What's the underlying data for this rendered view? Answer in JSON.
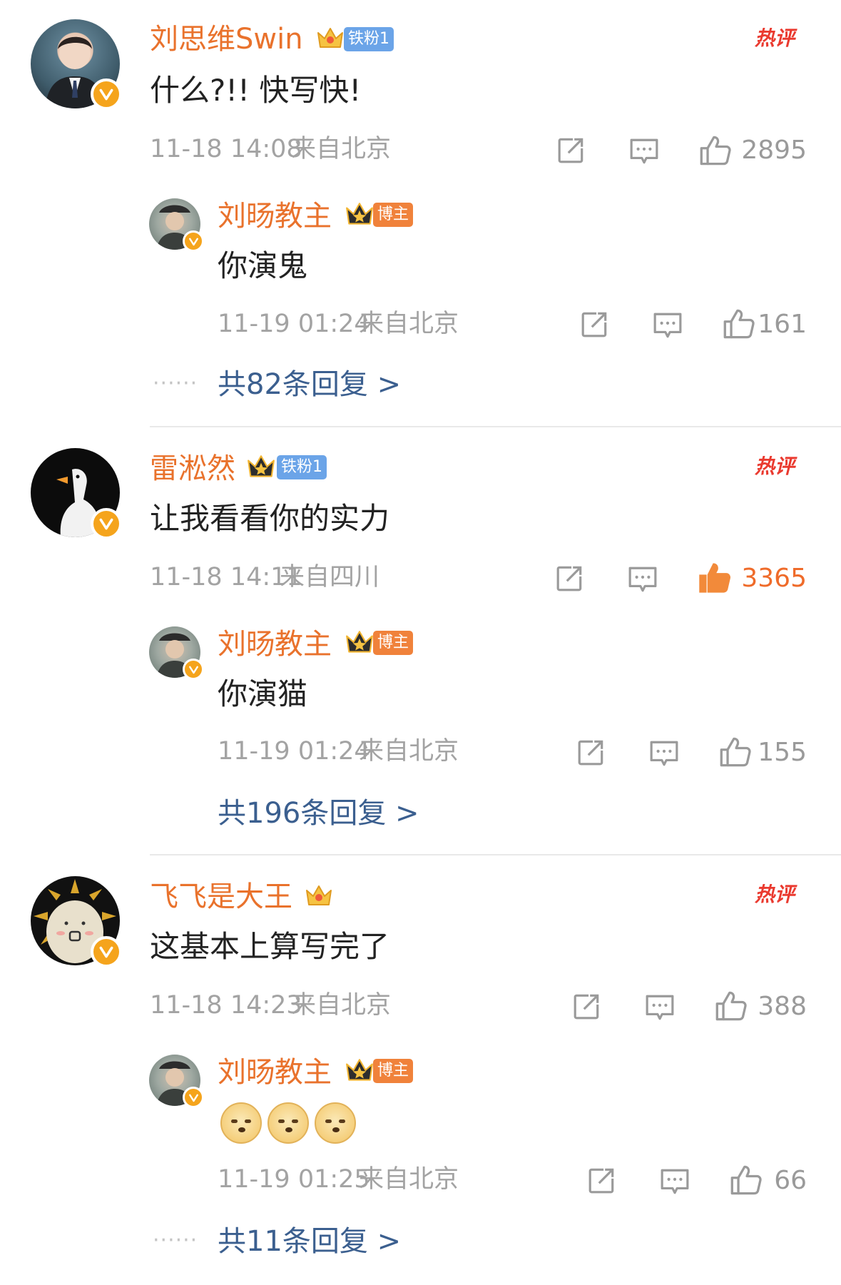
{
  "colors": {
    "name": "#e9722c",
    "link": "#3b5f8f",
    "meta": "#a3a3a3",
    "hot": "#ea3a2f",
    "liked": "#ef6b2a"
  },
  "comments": [
    {
      "user": "刘思维Swin",
      "crown_level": "7",
      "fan_badge": "铁粉1",
      "hot_tag": "热评",
      "text": "什么?!!  快写快!",
      "time": "11-18 14:08",
      "location": "来自北京",
      "likes": "2895",
      "liked": false,
      "reply": {
        "user": "刘旸教主",
        "crown_level": "II",
        "badge": "博主",
        "text": "你演鬼",
        "time": "11-19 01:24",
        "location": "来自北京",
        "likes": "161"
      },
      "more": "共82条回复 >",
      "more_dots": "······"
    },
    {
      "user": "雷淞然",
      "crown_level": "II",
      "fan_badge": "铁粉1",
      "hot_tag": "热评",
      "text": "让我看看你的实力",
      "time": "11-18 14:11",
      "location": "来自四川",
      "likes": "3365",
      "liked": true,
      "reply": {
        "user": "刘旸教主",
        "crown_level": "II",
        "badge": "博主",
        "text": "你演猫",
        "time": "11-19 01:24",
        "location": "来自北京",
        "likes": "155"
      },
      "more": "共196条回复 >"
    },
    {
      "user": "飞飞是大王",
      "crown_level": "7",
      "hot_tag": "热评",
      "text": "这基本上算写完了",
      "time": "11-18 14:23",
      "location": "来自北京",
      "likes": "388",
      "liked": false,
      "reply": {
        "user": "刘旸教主",
        "crown_level": "II",
        "badge": "博主",
        "emojis": [
          "doge-emoji",
          "doge-emoji",
          "doge-emoji"
        ],
        "time": "11-19 01:25",
        "location": "来自北京",
        "likes": "66"
      },
      "more": "共11条回复 >",
      "more_dots": "······"
    }
  ],
  "icons": {
    "share": "share-icon",
    "comment": "comment-icon",
    "like": "thumbs-up-icon",
    "verified": "verified-v-icon",
    "crown": "crown-icon"
  }
}
